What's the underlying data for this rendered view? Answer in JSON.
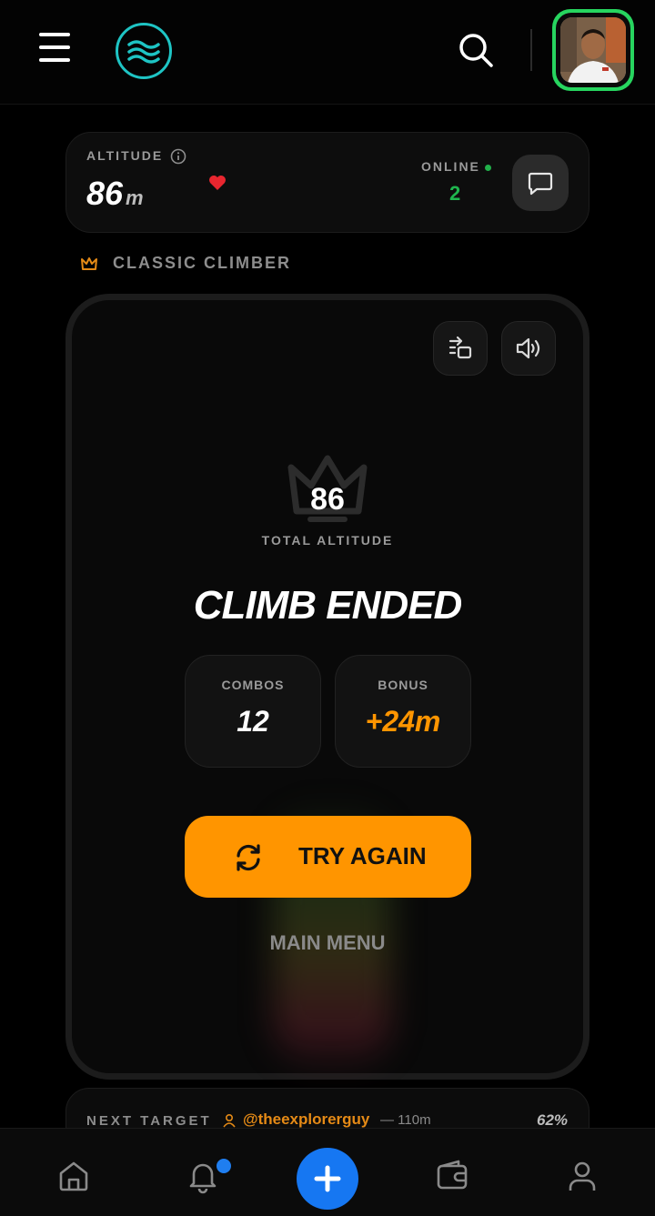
{
  "header": {
    "menu_icon": "hamburger-menu-icon",
    "logo_icon": "waves-logo-icon",
    "search_icon": "search-icon",
    "avatar_alt": "user-avatar"
  },
  "stats_bar": {
    "altitude_label": "ALTITUDE",
    "altitude_value": "86",
    "altitude_unit": "m",
    "online_label": "ONLINE",
    "online_count": "2",
    "chat_icon": "chat-icon",
    "heart_color": "#e8262f",
    "online_color": "#1fb54e"
  },
  "mode": {
    "label": "CLASSIC CLIMBER",
    "icon": "crown-icon"
  },
  "result": {
    "score": "86",
    "score_label": "TOTAL ALTITUDE",
    "title": "CLIMB ENDED",
    "combos_label": "COMBOS",
    "combos_value": "12",
    "bonus_label": "BONUS",
    "bonus_value": "+24m",
    "bonus_color": "#ff9500",
    "try_again_label": "TRY AGAIN",
    "main_menu_label": "MAIN MENU"
  },
  "next_target": {
    "label": "NEXT TARGET",
    "user": "@theexplorerguy",
    "distance": "— 110m",
    "percent": "62%"
  },
  "bottom_nav": {
    "items": [
      "home-icon",
      "bell-icon",
      "plus-icon",
      "wallet-icon",
      "profile-icon"
    ],
    "accent": "#1677f2"
  }
}
